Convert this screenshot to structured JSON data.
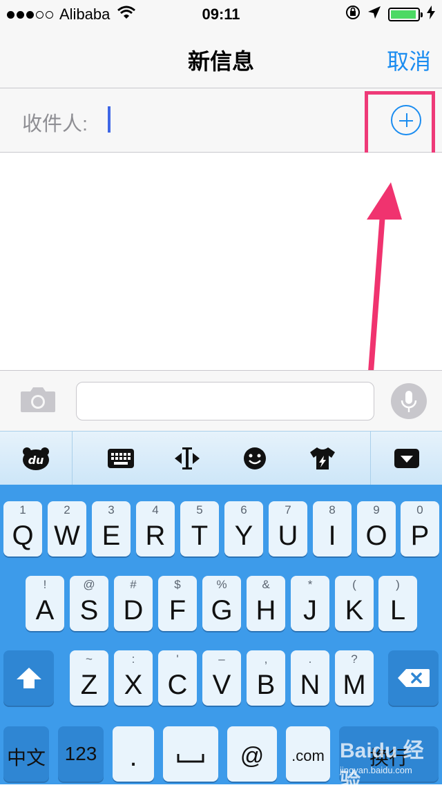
{
  "status": {
    "carrier": "Alibaba",
    "time": "09:11",
    "signal_bars": 3,
    "signal_total": 5,
    "battery_level": 0.95,
    "battery_color": "#4cd964"
  },
  "nav": {
    "title": "新信息",
    "cancel_label": "取消"
  },
  "recipient": {
    "label": "收件人:",
    "value": "",
    "add_icon": "plus-circle-icon"
  },
  "compose": {
    "camera_icon": "camera-icon",
    "message_value": "",
    "mic_icon": "microphone-icon"
  },
  "keyboard_toolbar": {
    "icons": [
      "baidu-bear-icon",
      "keyboard-icon",
      "cursor-move-icon",
      "emoji-icon",
      "theme-shirt-icon",
      "hide-keyboard-icon"
    ]
  },
  "keyboard": {
    "row1": [
      {
        "sec": "1",
        "pri": "Q"
      },
      {
        "sec": "2",
        "pri": "W"
      },
      {
        "sec": "3",
        "pri": "E"
      },
      {
        "sec": "4",
        "pri": "R"
      },
      {
        "sec": "5",
        "pri": "T"
      },
      {
        "sec": "6",
        "pri": "Y"
      },
      {
        "sec": "7",
        "pri": "U"
      },
      {
        "sec": "8",
        "pri": "I"
      },
      {
        "sec": "9",
        "pri": "O"
      },
      {
        "sec": "0",
        "pri": "P"
      }
    ],
    "row2": [
      {
        "sec": "!",
        "pri": "A"
      },
      {
        "sec": "@",
        "pri": "S"
      },
      {
        "sec": "#",
        "pri": "D"
      },
      {
        "sec": "$",
        "pri": "F"
      },
      {
        "sec": "%",
        "pri": "G"
      },
      {
        "sec": "&",
        "pri": "H"
      },
      {
        "sec": "*",
        "pri": "J"
      },
      {
        "sec": "(",
        "pri": "K"
      },
      {
        "sec": ")",
        "pri": "L"
      }
    ],
    "row3": [
      {
        "sec": "~",
        "pri": "Z"
      },
      {
        "sec": ":",
        "pri": "X"
      },
      {
        "sec": "'",
        "pri": "C"
      },
      {
        "sec": "–",
        "pri": "V"
      },
      {
        "sec": ",",
        "pri": "B"
      },
      {
        "sec": ".",
        "pri": "N"
      },
      {
        "sec": "?",
        "pri": "M"
      }
    ],
    "bottom": {
      "lang": "中文",
      "num": "123",
      "period": ".",
      "at": "@",
      "com": ".com",
      "return": "换行"
    },
    "shift_icon": "shift-icon",
    "delete_icon": "delete-icon",
    "space_icon": "space-bar-icon",
    "accent": "#3d9bea"
  },
  "watermark": {
    "text": "Baidu 经验",
    "url": "jingyan.baidu.com"
  }
}
